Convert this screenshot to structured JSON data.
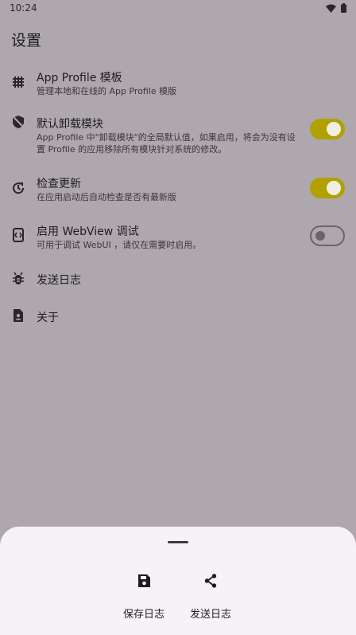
{
  "status_bar": {
    "time": "10:24",
    "wifi_icon": "wifi-icon",
    "battery_icon": "battery-icon"
  },
  "page": {
    "title": "设置"
  },
  "settings": [
    {
      "icon": "grid-icon",
      "title": "App Profile 模板",
      "description": "管理本地和在线的 App Profile 模版"
    },
    {
      "icon": "shield-off-icon",
      "title": "默认卸载模块",
      "description": "App Profile 中\"卸载模块\"的全局默认值，如果启用，将会为没有设置 Profile 的应用移除所有模块针对系统的修改。",
      "toggle": true
    },
    {
      "icon": "update-icon",
      "title": "检查更新",
      "description": "在应用启动后自动检查是否有最新版",
      "toggle": true
    },
    {
      "icon": "webview-icon",
      "title": "启用 WebView 调试",
      "description": "可用于调试 WebUI ，请仅在需要时启用。",
      "toggle": false
    },
    {
      "icon": "bug-icon",
      "title": "发送日志"
    },
    {
      "icon": "contact-file-icon",
      "title": "关于"
    }
  ],
  "bottom_sheet": {
    "actions": [
      {
        "icon": "save-icon",
        "label": "保存日志"
      },
      {
        "icon": "share-icon",
        "label": "发送日志"
      }
    ]
  },
  "colors": {
    "accent": "#b0a100",
    "scrim_background": "#aea8ae",
    "sheet_background": "#f7f1f8"
  }
}
